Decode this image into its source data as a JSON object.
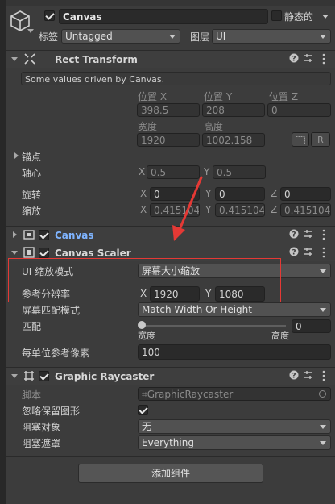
{
  "gameobject": {
    "name": "Canvas",
    "static_label": "静态的",
    "tag_label": "标签",
    "tag_value": "Untagged",
    "layer_label": "图层",
    "layer_value": "UI"
  },
  "rect_transform": {
    "title": "Rect Transform",
    "notice": "Some values driven by Canvas.",
    "pos_x_label": "位置 X",
    "pos_y_label": "位置 Y",
    "pos_z_label": "位置 Z",
    "pos_x": "398.5",
    "pos_y": "208",
    "pos_z": "0",
    "width_label": "宽度",
    "height_label": "高度",
    "width": "1920",
    "height": "1002.158",
    "r_button": "R",
    "anchors_label": "锚点",
    "pivot_label": "轴心",
    "pivot_x": "0.5",
    "pivot_y": "0.5",
    "rotation_label": "旋转",
    "rot_x": "0",
    "rot_y": "0",
    "rot_z": "0",
    "scale_label": "缩放",
    "scale_x": "0.4151042",
    "scale_y": "0.4151042",
    "scale_z": "0.4151042"
  },
  "axes": {
    "x": "X",
    "y": "Y",
    "z": "Z"
  },
  "canvas": {
    "title": "Canvas"
  },
  "canvas_scaler": {
    "title": "Canvas Scaler",
    "ui_scale_mode_label": "UI 缩放模式",
    "ui_scale_mode_value": "屏幕大小缩放",
    "ref_res_label": "参考分辨率",
    "ref_x": "1920",
    "ref_y": "1080",
    "match_mode_label": "屏幕匹配模式",
    "match_mode_value": "Match Width Or Height",
    "match_label": "匹配",
    "match_value": "0",
    "match_fraction": 0,
    "slider_left": "宽度",
    "slider_right": "高度",
    "ref_ppu_label": "每单位参考像素",
    "ref_ppu_value": "100"
  },
  "graphic_raycaster": {
    "title": "Graphic Raycaster",
    "script_label": "脚本",
    "script_value": "GraphicRaycaster",
    "ignore_reversed_label": "忽略保留图形",
    "ignore_reversed_checked": true,
    "blocking_objects_label": "阻塞对象",
    "blocking_objects_value": "无",
    "blocking_mask_label": "阻塞遮罩",
    "blocking_mask_value": "Everything"
  },
  "add_component_label": "添加组件",
  "colors": {
    "highlight_box": "#e53935",
    "arrow": "#e53935",
    "link_blue": "#7fb4ff",
    "background": "#3c3c3c"
  },
  "icons": [
    "cube-icon",
    "rect-transform-icon",
    "canvas-icon",
    "canvas-scaler-icon",
    "graphic-raycaster-icon",
    "help-icon",
    "preset-icon",
    "kebab-menu-icon"
  ]
}
